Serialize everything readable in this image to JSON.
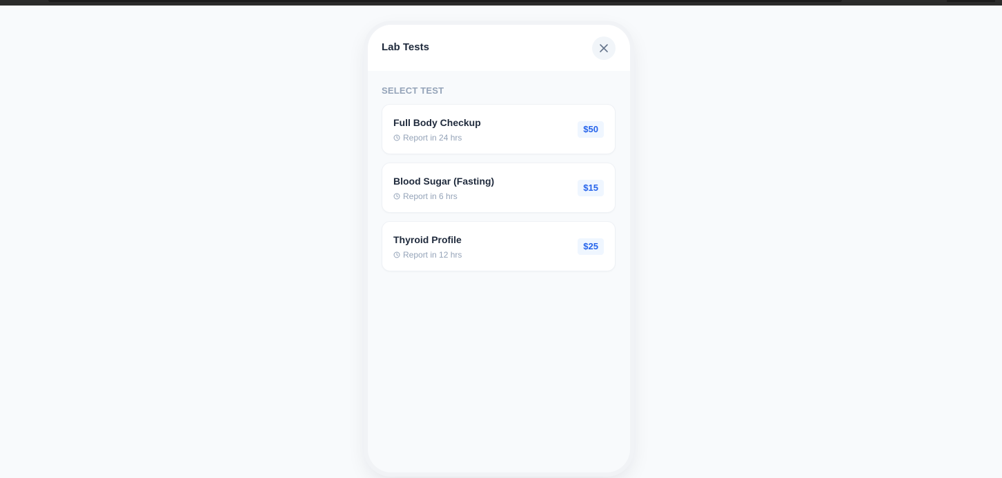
{
  "modal": {
    "title": "Lab Tests",
    "close_icon": "close-icon"
  },
  "section": {
    "label": "SELECT TEST"
  },
  "tests": [
    {
      "name": "Full Body Checkup",
      "report": "Report in 24 hrs",
      "price": "$50"
    },
    {
      "name": "Blood Sugar (Fasting)",
      "report": "Report in 6 hrs",
      "price": "$15"
    },
    {
      "name": "Thyroid Profile",
      "report": "Report in 12 hrs",
      "price": "$25"
    }
  ],
  "colors": {
    "accent": "#2563eb",
    "accent_bg": "#eff6ff",
    "text_primary": "#1e293b",
    "text_muted": "#94a3b8",
    "background": "#f8fafc"
  },
  "icons": {
    "clock": "clock-icon",
    "close": "close-icon"
  }
}
